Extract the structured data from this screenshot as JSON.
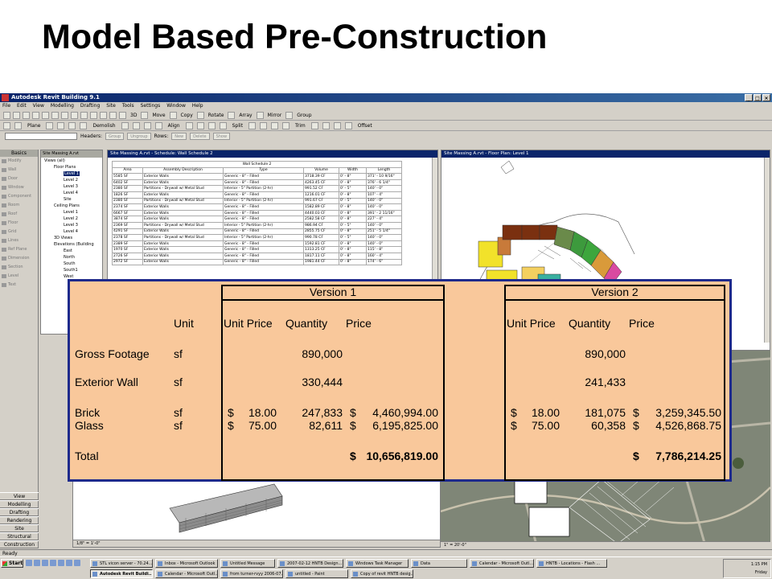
{
  "slide": {
    "title": "Model Based Pre-Construction"
  },
  "revit": {
    "window_title": "Autodesk Revit Building 9.1",
    "menu": [
      "File",
      "Edit",
      "View",
      "Modelling",
      "Drafting",
      "Site",
      "Tools",
      "Settings",
      "Window",
      "Help"
    ],
    "toolbar_text": [
      "3D",
      "Move",
      "Copy",
      "Rotate",
      "Array",
      "Mirror",
      "Group"
    ],
    "toolbar2_text": [
      "Plane",
      "Demolish",
      "Align",
      "Split",
      "Trim",
      "Offset"
    ],
    "toolbar3": {
      "headers_label": "Headers:",
      "group": "Group",
      "ungroup": "Ungroup",
      "rows_label": "Rows:",
      "new": "New",
      "delete": "Delete",
      "show": "Show"
    },
    "design_bar": {
      "header": "Basics",
      "items": [
        "Modify",
        "Wall",
        "Door",
        "Window",
        "Component",
        "Room",
        "Roof",
        "Floor",
        "Grid",
        "Lines",
        "Ref Plane",
        "Dimension",
        "Section",
        "Level",
        "Text"
      ],
      "tabs": [
        "View",
        "Modelling",
        "Drafting",
        "Rendering",
        "Site",
        "Structural",
        "Construction"
      ]
    },
    "browser": {
      "title": "Site Massing A.rvt",
      "tree": [
        {
          "label": "Views (all)",
          "indent": 0
        },
        {
          "label": "Floor Plans",
          "indent": 1
        },
        {
          "label": "Level 1",
          "indent": 2,
          "selected": true
        },
        {
          "label": "Level 2",
          "indent": 2
        },
        {
          "label": "Level 3",
          "indent": 2
        },
        {
          "label": "Level 4",
          "indent": 2
        },
        {
          "label": "Site",
          "indent": 2
        },
        {
          "label": "Ceiling Plans",
          "indent": 1
        },
        {
          "label": "Level 1",
          "indent": 2
        },
        {
          "label": "Level 2",
          "indent": 2
        },
        {
          "label": "Level 3",
          "indent": 2
        },
        {
          "label": "Level 4",
          "indent": 2
        },
        {
          "label": "3D Views",
          "indent": 1
        },
        {
          "label": "Elevations (Building",
          "indent": 1
        },
        {
          "label": "East",
          "indent": 2
        },
        {
          "label": "North",
          "indent": 2
        },
        {
          "label": "South",
          "indent": 2
        },
        {
          "label": "South1",
          "indent": 2
        },
        {
          "label": "West",
          "indent": 2
        }
      ]
    },
    "schedule": {
      "window_title": "Site Massing A.rvt - Schedule: Wall Schedule 2",
      "caption": "Wall Schedule 2",
      "headers": [
        "Area",
        "Assembly Description",
        "Type",
        "Volume",
        "Width",
        "Length"
      ],
      "rows": [
        [
          "5585 SF",
          "Exterior Walls",
          "Generic - 8\" - Filled",
          "3718.39 CF",
          "0' - 8\"",
          "371' - 10 9/16\""
        ],
        [
          "6402 SF",
          "Exterior Walls",
          "Generic - 8\" - Filled",
          "4263.45 CF",
          "0' - 8\"",
          "376' - 6 1/4\""
        ],
        [
          "2380 SF",
          "Partitions - Drywall w/ Metal Stud",
          "Interior - 5\" Partition (2-hr)",
          "991.52 CF",
          "0' - 5\"",
          "140' - 0\""
        ],
        [
          "1826 SF",
          "Exterior Walls",
          "Generic - 8\" - Filled",
          "1216.01 CF",
          "0' - 8\"",
          "107' - 4\""
        ],
        [
          "2380 SF",
          "Partitions - Drywall w/ Metal Stud",
          "Interior - 5\" Partition (2-hr)",
          "991.67 CF",
          "0' - 5\"",
          "140' - 0\""
        ],
        [
          "2374 SF",
          "Exterior Walls",
          "Generic - 8\" - Filled",
          "1582.89 CF",
          "0' - 8\"",
          "140' - 0\""
        ],
        [
          "6667 SF",
          "Exterior Walls",
          "Generic - 8\" - Filled",
          "4440.03 CF",
          "0' - 8\"",
          "391' - 2 11/16\""
        ],
        [
          "3874 SF",
          "Exterior Walls",
          "Generic - 8\" - Filled",
          "2582.58 CF",
          "0' - 8\"",
          "227' - 4\""
        ],
        [
          "2369 SF",
          "Partitions - Drywall w/ Metal Stud",
          "Interior - 5\" Partition (2-hr)",
          "986.94 CF",
          "0' - 5\"",
          "140' - 0\""
        ],
        [
          "4291 SF",
          "Exterior Walls",
          "Generic - 8\" - Filled",
          "2855.75 CF",
          "0' - 8\"",
          "251' - 5 1/4\""
        ],
        [
          "2378 SF",
          "Partitions - Drywall w/ Metal Stud",
          "Interior - 5\" Partition (2-hr)",
          "990.78 CF",
          "0' - 5\"",
          "140' - 0\""
        ],
        [
          "2389 SF",
          "Exterior Walls",
          "Generic - 8\" - Filled",
          "1592.81 CF",
          "0' - 8\"",
          "140' - 0\""
        ],
        [
          "1970 SF",
          "Exterior Walls",
          "Generic - 8\" - Filled",
          "1313.25 CF",
          "0' - 8\"",
          "115' - 8\""
        ],
        [
          "2726 SF",
          "Exterior Walls",
          "Generic - 8\" - Filled",
          "1817.11 CF",
          "0' - 8\"",
          "160' - 4\""
        ],
        [
          "2972 SF",
          "Exterior Walls",
          "Generic - 8\" - Filled",
          "1981.44 CF",
          "0' - 8\"",
          "174' - 6\""
        ]
      ]
    },
    "floorplan": {
      "window_title": "Site Massing A.rvt - Floor Plan: Level 1"
    },
    "view_scale_left": "1/8\" = 1'-0\"",
    "view_scale_right": "1\" = 20'-0\"",
    "status": "Ready",
    "taskbar": {
      "start": "Start",
      "row1": [
        "STL vicon server - 70.24...",
        "Inbox - Microsoft Outlook",
        "Untitled Message",
        "2007-02-12 HNTB Design...",
        "Windows Task Manager",
        "Data",
        "Calendar - Microsoft Outl...",
        "HNTB - Locations - Flash ..."
      ],
      "row2": [
        "Autodesk Revit Buildi...",
        "Calendar - Microsoft Outl...",
        "from turner-rvyy 2006-07...",
        "untitled - Paint",
        "Copy of revit HNTB desig..."
      ],
      "time": "1:15 PM",
      "day": "Friday"
    }
  },
  "cost_table": {
    "version1": "Version 1",
    "version2": "Version 2",
    "col_unit": "Unit",
    "col_unit_price": "Unit Price",
    "col_quantity": "Quantity",
    "col_price": "Price",
    "rows": {
      "gross": {
        "label": "Gross Footage",
        "unit": "sf",
        "v1_qty": "890,000",
        "v2_qty": "890,000"
      },
      "exterior": {
        "label": "Exterior Wall",
        "unit": "sf",
        "v1_qty": "330,444",
        "v2_qty": "241,433"
      },
      "brick": {
        "label": "Brick",
        "unit": "sf",
        "v1_up": "18.00",
        "v1_qty": "247,833",
        "v1_price": "4,460,994.00",
        "v2_up": "18.00",
        "v2_qty": "181,075",
        "v2_price": "3,259,345.50"
      },
      "glass": {
        "label": "Glass",
        "unit": "sf",
        "v1_up": "75.00",
        "v1_qty": "82,611",
        "v1_price": "6,195,825.00",
        "v2_up": "75.00",
        "v2_qty": "60,358",
        "v2_price": "4,526,868.75"
      },
      "total": {
        "label": "Total",
        "v1_price": "10,656,819.00",
        "v2_price": "7,786,214.25"
      }
    },
    "currency": "$"
  }
}
